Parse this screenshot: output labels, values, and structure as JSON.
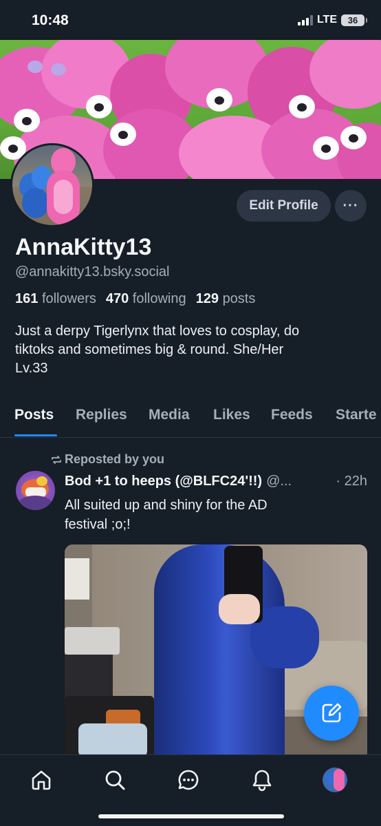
{
  "status_bar": {
    "time": "10:48",
    "network": "LTE",
    "battery": "36"
  },
  "profile": {
    "display_name": "AnnaKitty13",
    "handle": "@annakitty13.bsky.social",
    "followers_count": "161",
    "followers_label": "followers",
    "following_count": "470",
    "following_label": "following",
    "posts_count": "129",
    "posts_label": "posts",
    "bio_line1": "Just a derpy Tigerlynx that loves to cosplay, do",
    "bio_line2": "tiktoks and sometimes big & round. She/Her",
    "bio_line3": "Lv.33",
    "edit_label": "Edit Profile",
    "more_label": "···"
  },
  "tabs": {
    "posts": "Posts",
    "replies": "Replies",
    "media": "Media",
    "likes": "Likes",
    "feeds": "Feeds",
    "starter": "Starte"
  },
  "post": {
    "repost_label": "Reposted by you",
    "author": "Bod +1 to heeps (@BLFC24'!!)",
    "handle": "@...",
    "time": "· 22h",
    "text_line1": "All suited up and shiny for the AD",
    "text_line2": "festival ;o;!"
  },
  "icons": {
    "home": "home-icon",
    "search": "search-icon",
    "chat": "chat-icon",
    "notifications": "bell-icon",
    "compose": "compose-icon",
    "repost": "repost-icon"
  },
  "colors": {
    "background": "#161e27",
    "accent": "#208bfe",
    "muted_text": "#a6aeb8",
    "banner_plush": "#e85fb6"
  }
}
